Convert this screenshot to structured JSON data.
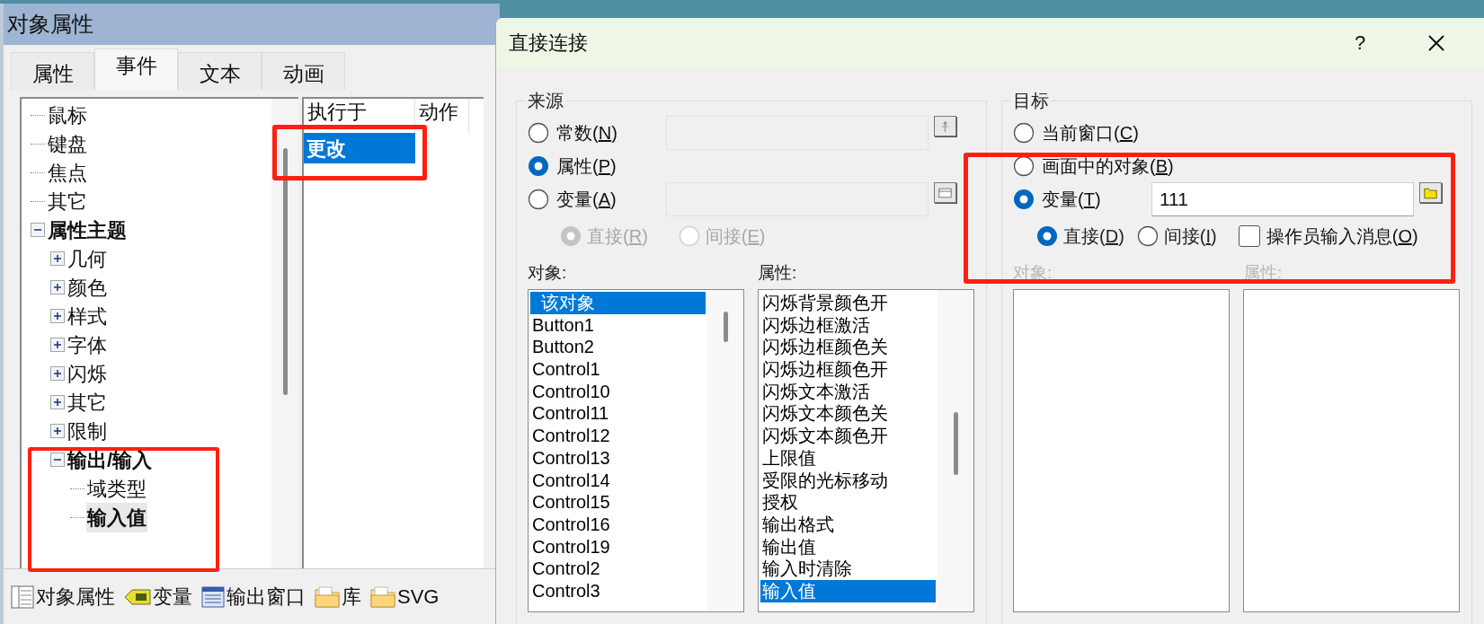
{
  "object_properties": {
    "title": "对象属性",
    "tabs": [
      {
        "label": "属性",
        "selected": false
      },
      {
        "label": "事件",
        "selected": true
      },
      {
        "label": "文本",
        "selected": false
      },
      {
        "label": "动画",
        "selected": false
      }
    ],
    "tree": [
      {
        "label": "鼠标"
      },
      {
        "label": "键盘"
      },
      {
        "label": "焦点"
      },
      {
        "label": "其它"
      },
      {
        "label": "属性主题",
        "expanded": true,
        "children": [
          {
            "label": "几何",
            "expanded": false
          },
          {
            "label": "颜色",
            "expanded": false
          },
          {
            "label": "样式",
            "expanded": false
          },
          {
            "label": "字体",
            "expanded": false
          },
          {
            "label": "闪烁",
            "expanded": false
          },
          {
            "label": "其它",
            "expanded": false
          },
          {
            "label": "限制",
            "expanded": false
          },
          {
            "label": "输出/输入",
            "expanded": true,
            "children": [
              {
                "label": "域类型",
                "selected": false
              },
              {
                "label": "输入值",
                "selected": true
              }
            ]
          }
        ]
      }
    ],
    "event_table": {
      "columns": [
        "执行于",
        "动作"
      ],
      "rows": [
        {
          "label": "更改",
          "selected": true
        }
      ]
    },
    "bottom_tabs": [
      {
        "label": "对象属性",
        "kind": "properties"
      },
      {
        "label": "变量",
        "kind": "tag"
      },
      {
        "label": "输出窗口",
        "kind": "window"
      },
      {
        "label": "库",
        "kind": "folder"
      },
      {
        "label": "SVG",
        "kind": "folder"
      }
    ]
  },
  "dialog": {
    "title": "直接连接",
    "help": "?",
    "source": {
      "title": "来源",
      "options": [
        {
          "label": "常数(N)",
          "selected": false,
          "kind": "pin"
        },
        {
          "label": "属性(P)",
          "selected": true,
          "kind": "plain"
        },
        {
          "label": "变量(A)",
          "selected": false,
          "kind": "window"
        }
      ],
      "sub_options": [
        {
          "label": "直接(R)",
          "selected": true,
          "disabled": true
        },
        {
          "label": "间接(E)",
          "selected": false,
          "disabled": true
        }
      ],
      "objects_label": "对象:",
      "properties_label": "属性:",
      "labels_disabled": false,
      "objects": [
        {
          "label": "该对象",
          "selected": true
        },
        {
          "label": "Button1",
          "selected": false
        },
        {
          "label": "Button2",
          "selected": false
        },
        {
          "label": "Control1",
          "selected": false
        },
        {
          "label": "Control10",
          "selected": false
        },
        {
          "label": "Control11",
          "selected": false
        },
        {
          "label": "Control12",
          "selected": false
        },
        {
          "label": "Control13",
          "selected": false
        },
        {
          "label": "Control14",
          "selected": false
        },
        {
          "label": "Control15",
          "selected": false
        },
        {
          "label": "Control16",
          "selected": false
        },
        {
          "label": "Control19",
          "selected": false
        },
        {
          "label": "Control2",
          "selected": false
        },
        {
          "label": "Control3",
          "selected": false
        }
      ],
      "properties": [
        {
          "label": "闪烁背景颜色开",
          "selected": false
        },
        {
          "label": "闪烁边框激活",
          "selected": false
        },
        {
          "label": "闪烁边框颜色关",
          "selected": false
        },
        {
          "label": "闪烁边框颜色开",
          "selected": false
        },
        {
          "label": "闪烁文本激活",
          "selected": false
        },
        {
          "label": "闪烁文本颜色关",
          "selected": false
        },
        {
          "label": "闪烁文本颜色开",
          "selected": false
        },
        {
          "label": "上限值",
          "selected": false
        },
        {
          "label": "受限的光标移动",
          "selected": false
        },
        {
          "label": "授权",
          "selected": false
        },
        {
          "label": "输出格式",
          "selected": false
        },
        {
          "label": "输出值",
          "selected": false
        },
        {
          "label": "输入时清除",
          "selected": false
        },
        {
          "label": "输入值",
          "selected": true
        }
      ]
    },
    "target": {
      "title": "目标",
      "options": [
        {
          "label": "当前窗口(C)",
          "selected": false,
          "kind": "plain"
        },
        {
          "label": "画面中的对象(B)",
          "selected": false,
          "kind": "plain"
        },
        {
          "label": "变量(T)",
          "selected": true,
          "kind": "folder",
          "value": "111"
        }
      ],
      "sub_options": [
        {
          "label": "直接(D)",
          "selected": true,
          "disabled": false
        },
        {
          "label": "间接(I)",
          "selected": false,
          "disabled": false
        }
      ],
      "checkbox": {
        "label": "操作员输入消息(O)",
        "checked": false
      },
      "objects_label": "对象:",
      "properties_label": "属性:",
      "labels_disabled": true
    }
  }
}
